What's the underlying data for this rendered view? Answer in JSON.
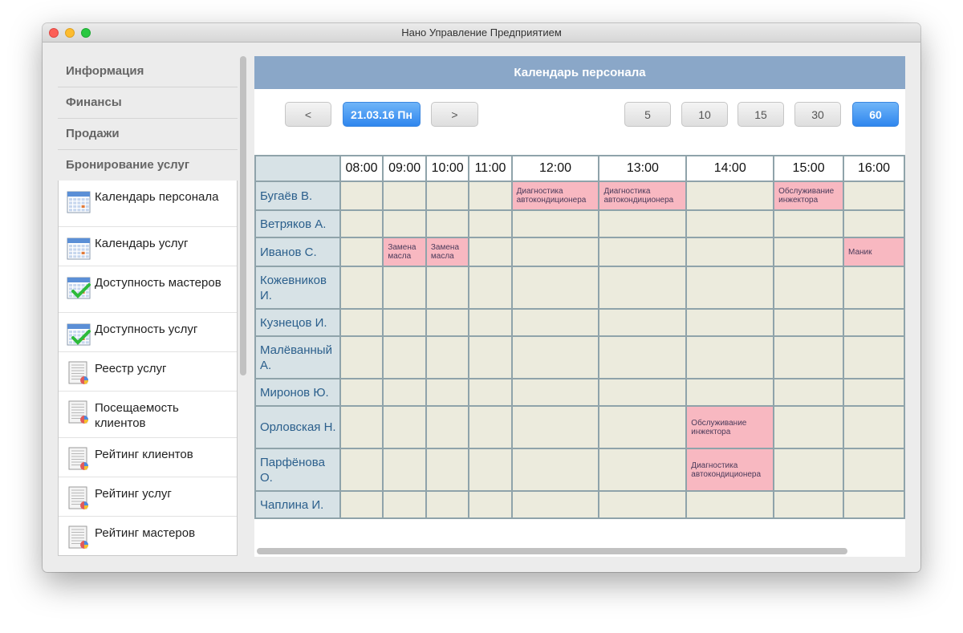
{
  "window": {
    "title": "Нано Управление Предприятием"
  },
  "sidebar": {
    "sections": [
      "Информация",
      "Финансы",
      "Продажи",
      "Бронирование услуг"
    ],
    "items": [
      {
        "label": "Календарь персонала",
        "icon": "calendar-icon"
      },
      {
        "label": "Календарь услуг",
        "icon": "calendar-icon"
      },
      {
        "label": "Доступность мастеров",
        "icon": "calendar-check-icon"
      },
      {
        "label": "Доступность услуг",
        "icon": "calendar-check-icon"
      },
      {
        "label": "Реестр услуг",
        "icon": "report-icon"
      },
      {
        "label": "Посещаемость клиентов",
        "icon": "report-icon"
      },
      {
        "label": "Рейтинг клиентов",
        "icon": "report-icon"
      },
      {
        "label": "Рейтинг услуг",
        "icon": "report-icon"
      },
      {
        "label": "Рейтинг мастеров",
        "icon": "report-icon"
      }
    ]
  },
  "calendar": {
    "title": "Календарь персонала",
    "prev_label": "<",
    "date_label": "21.03.16 Пн",
    "next_label": ">",
    "intervals": [
      "5",
      "10",
      "15",
      "30",
      "60"
    ],
    "selected_interval": "60",
    "hours": [
      "08:00",
      "09:00",
      "10:00",
      "11:00",
      "12:00",
      "13:00",
      "14:00",
      "15:00",
      "16:00"
    ],
    "staff": [
      "Бугаёв В.",
      "Ветряков А.",
      "Иванов С.",
      "Кожевников И.",
      "Кузнецов И.",
      "Малёванный А.",
      "Миронов Ю.",
      "Орловская Н.",
      "Парфёнова О.",
      "Чаплина И."
    ],
    "appointments": [
      {
        "staff": "Бугаёв В.",
        "hour": "12:00",
        "lines": [
          "Диагностика",
          "автокондиционера"
        ]
      },
      {
        "staff": "Бугаёв В.",
        "hour": "13:00",
        "lines": [
          "Диагностика",
          "автокондиционера"
        ]
      },
      {
        "staff": "Бугаёв В.",
        "hour": "15:00",
        "lines": [
          "Обслуживание",
          "инжектора"
        ]
      },
      {
        "staff": "Иванов С.",
        "hour": "09:00",
        "lines": [
          "Замена",
          "масла"
        ]
      },
      {
        "staff": "Иванов С.",
        "hour": "10:00",
        "lines": [
          "Замена",
          "масла"
        ]
      },
      {
        "staff": "Иванов С.",
        "hour": "16:00",
        "lines": [
          "Маник"
        ]
      },
      {
        "staff": "Орловская Н.",
        "hour": "14:00",
        "lines": [
          "Обслуживание",
          "инжектора"
        ]
      },
      {
        "staff": "Парфёнова О.",
        "hour": "14:00",
        "lines": [
          "Диагностика",
          "автокондиционера"
        ]
      }
    ]
  },
  "colors": {
    "header": "#8aa7c8",
    "appointment": "#f8b8c1",
    "cell": "#ecebdd",
    "name_cell": "#d7e2e6",
    "accent": "#2f86ee"
  }
}
